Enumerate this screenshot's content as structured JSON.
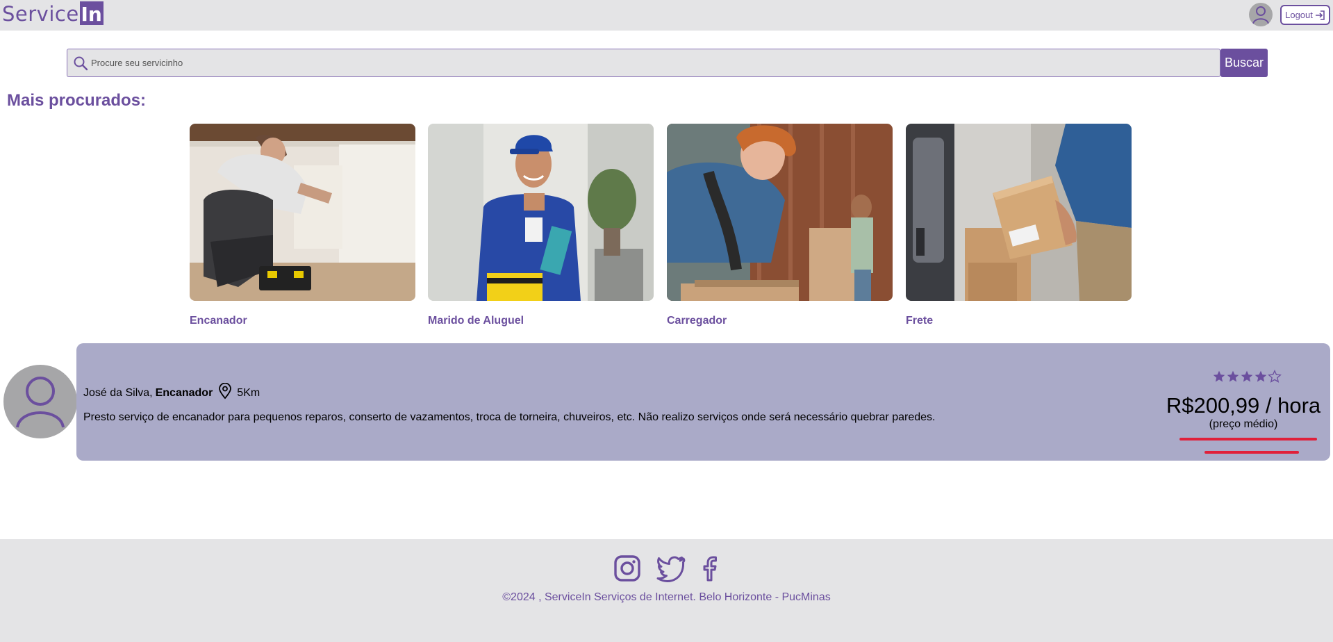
{
  "header": {
    "logo_text": "Service",
    "logo_box_text": "In",
    "logout_label": "Logout"
  },
  "search": {
    "placeholder": "Procure seu servicinho",
    "button_label": "Buscar"
  },
  "popular": {
    "title": "Mais procurados:",
    "items": [
      {
        "label": "Encanador",
        "image": "plumber-photo"
      },
      {
        "label": "Marido de Aluguel",
        "image": "handyman-photo"
      },
      {
        "label": "Carregador",
        "image": "movers-photo"
      },
      {
        "label": "Frete",
        "image": "delivery-photo"
      }
    ]
  },
  "provider": {
    "name": "José da Silva,",
    "profession": "Encanador",
    "distance": "5Km",
    "description": "Presto serviço de encanador para pequenos reparos, conserto de vazamentos, troca de torneira, chuveiros, etc. Não realizo serviços onde será necessário quebrar paredes.",
    "rating": 4,
    "rating_max": 5,
    "price": "R$200,99 / hora",
    "price_note": "(preço médio)"
  },
  "footer": {
    "social": [
      "instagram-icon",
      "twitter-icon",
      "facebook-icon"
    ],
    "copyright": "©2024 , ServiceIn Serviços de Internet. Belo Horizonte - PucMinas"
  },
  "colors": {
    "brand": "#6b4f9e",
    "card_bg": "#aaaac8",
    "header_bg": "#e4e4e6",
    "underline": "#e0203a"
  }
}
